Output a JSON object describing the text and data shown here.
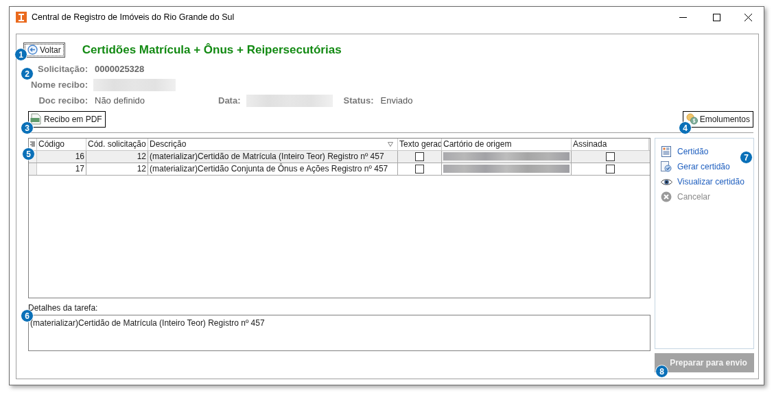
{
  "window": {
    "title": "Central de Registro de Imóveis do Rio Grande do Sul"
  },
  "back_button": {
    "label": "Voltar"
  },
  "heading": "Certidões Matrícula + Ônus + Reipersecutórias",
  "info_rows": [
    [
      {
        "label": "Solicitação:",
        "value": "0000025328",
        "strong": true
      }
    ],
    [
      {
        "label": "Nome recibo:",
        "redacted": true
      }
    ],
    [
      {
        "label": "Doc recibo:",
        "value": "Não definido",
        "strong": false
      },
      {
        "label": "Data:",
        "redacted": true
      },
      {
        "label": "Status:",
        "value": "Enviado",
        "strong": false
      }
    ]
  ],
  "pdf_button": {
    "label": "Recibo em PDF"
  },
  "fees_button": {
    "label": "Emolumentos"
  },
  "table": {
    "columns": [
      "Código",
      "Cód. solicitação",
      "Descrição",
      "Texto gerad",
      "Cartório de origem",
      "Assinada"
    ],
    "rows": [
      {
        "selected": true,
        "code": "16",
        "request": "12",
        "description": "(materializar)Certidão de Matrícula (Inteiro Teor) Registro nº 457",
        "text_generated": false,
        "origin_redacted": true,
        "signed": false
      },
      {
        "selected": false,
        "code": "17",
        "request": "12",
        "description": "(materializar)Certidão Conjunta de Ônus e Ações Registro nº 457",
        "text_generated": false,
        "origin_redacted": true,
        "signed": false
      }
    ]
  },
  "actions": [
    {
      "kind": "certificate",
      "label": "Certidão",
      "disabled": false
    },
    {
      "kind": "generate",
      "label": "Gerar certidão",
      "disabled": false
    },
    {
      "kind": "view",
      "label": "Visualizar certidão",
      "disabled": false
    },
    {
      "kind": "cancel",
      "label": "Cancelar",
      "disabled": true
    }
  ],
  "details": {
    "label": "Detalhes da tarefa:",
    "value": "(materializar)Certidão de Matrícula (Inteiro Teor) Registro nº 457"
  },
  "submit_button": {
    "label": "Preparar para envio",
    "disabled": true
  },
  "callouts": [
    "1",
    "2",
    "3",
    "4",
    "5",
    "6",
    "7",
    "8"
  ]
}
